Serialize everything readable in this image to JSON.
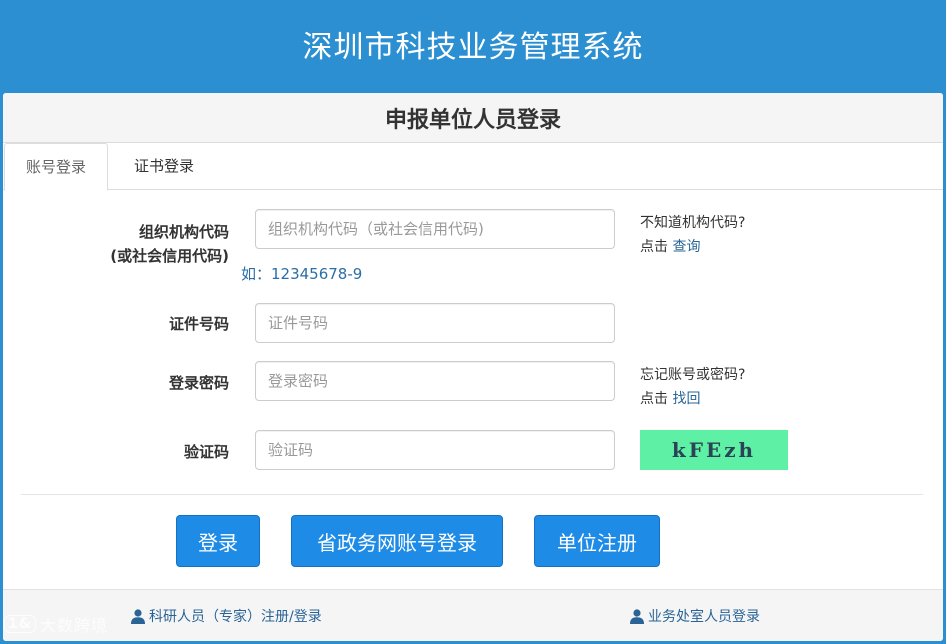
{
  "header": {
    "title": "深圳市科技业务管理系统"
  },
  "panel": {
    "title": "申报单位人员登录"
  },
  "tabs": [
    {
      "label": "账号登录"
    },
    {
      "label": "证书登录"
    }
  ],
  "form": {
    "org_label_1": "组织机构代码",
    "org_label_2": "(或社会信用代码)",
    "org_placeholder": "组织机构代码（或社会信用代码)",
    "org_example": "如：12345678-9",
    "id_label": "证件号码",
    "id_placeholder": "证件号码",
    "password_label": "登录密码",
    "password_placeholder": "登录密码",
    "captcha_label": "验证码",
    "captcha_placeholder": "验证码",
    "captcha_text": "kFEzh"
  },
  "help": {
    "org_question": "不知道机构代码?",
    "org_click": "点击",
    "org_link": "查询",
    "forgot_question": "忘记账号或密码?",
    "forgot_click": "点击",
    "forgot_link": "找回"
  },
  "buttons": {
    "login": "登录",
    "gov_login": "省政务网账号登录",
    "register": "单位注册"
  },
  "footer": {
    "researcher_link": "科研人员（专家）注册/登录",
    "office_link": "业务处室人员登录"
  },
  "watermark": {
    "logo": "1&",
    "text": "大数跨境"
  },
  "colors": {
    "brand": "#2b8fd1",
    "button": "#1e8be6",
    "captcha_bg": "#5ef0a4",
    "link": "#2a6496"
  }
}
